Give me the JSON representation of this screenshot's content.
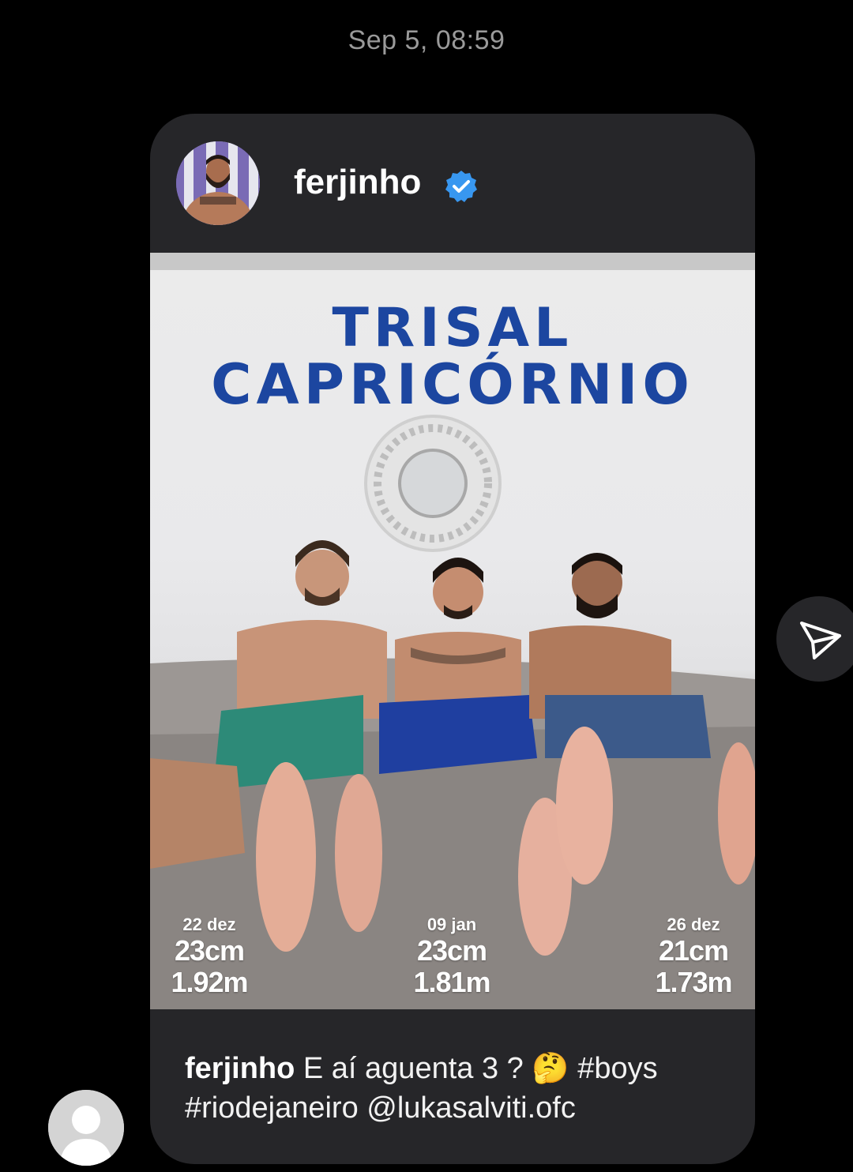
{
  "message": {
    "timestamp": "Sep 5, 08:59"
  },
  "post": {
    "author": "ferjinho",
    "verified": true,
    "image": {
      "title_line_1": "TRISAL",
      "title_line_2": "CAPRICÓRNIO",
      "stats": [
        {
          "date": "22 dez",
          "line1": "23cm",
          "line2": "1.92m"
        },
        {
          "date": "09 jan",
          "line1": "23cm",
          "line2": "1.81m"
        },
        {
          "date": "26 dez",
          "line1": "21cm",
          "line2": "1.73m"
        }
      ]
    },
    "caption": {
      "user": "ferjinho",
      "text": " E aí aguenta 3 ? 🤔 #boys #riodejaneiro @lukasalviti.ofc"
    }
  },
  "colors": {
    "background": "#000000",
    "card": "#262629",
    "verified_blue": "#3897f0",
    "title_blue": "#1c46a0"
  },
  "icons": {
    "share": "paper-plane-icon",
    "verified": "verified-badge-icon",
    "viewer_avatar": "default-avatar-icon"
  }
}
